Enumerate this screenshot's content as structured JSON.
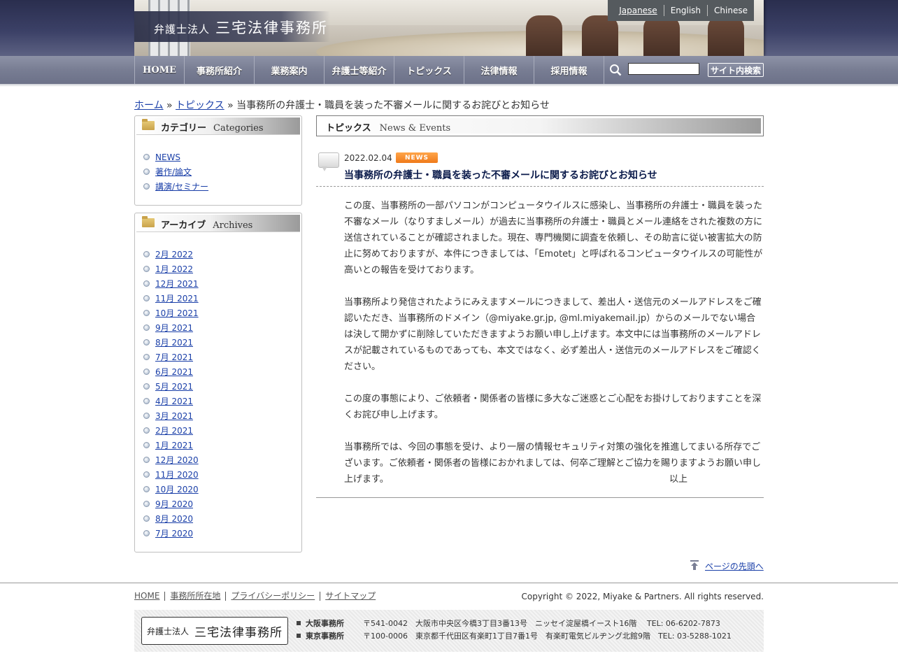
{
  "header": {
    "logo_small": "弁護士法人",
    "logo_big": "三宅法律事務所",
    "languages": [
      "Japanese",
      "English",
      "Chinese"
    ]
  },
  "nav": {
    "items": [
      "HOME",
      "事務所紹介",
      "業務案内",
      "弁護士等紹介",
      "トピックス",
      "法律情報",
      "採用情報"
    ],
    "search_button": "サイト内検索",
    "search_value": ""
  },
  "breadcrumb": {
    "home": "ホーム",
    "sep1": " » ",
    "topics": "トピックス",
    "sep2": " » ",
    "current": "当事務所の弁護士・職員を装った不審メールに関するお詫びとお知らせ"
  },
  "sidebar": {
    "categories": {
      "title": "カテゴリー",
      "title_en": "Categories",
      "items": [
        "NEWS",
        "著作/論文",
        "講演/セミナー"
      ]
    },
    "archives": {
      "title": "アーカイブ",
      "title_en": "Archives",
      "items": [
        "2月 2022",
        "1月 2022",
        "12月 2021",
        "11月 2021",
        "10月 2021",
        "9月 2021",
        "8月 2021",
        "7月 2021",
        "6月 2021",
        "5月 2021",
        "4月 2021",
        "3月 2021",
        "2月 2021",
        "1月 2021",
        "12月 2020",
        "11月 2020",
        "10月 2020",
        "9月 2020",
        "8月 2020",
        "7月 2020"
      ]
    }
  },
  "main": {
    "section_title": "トピックス",
    "section_title_en": "News & Events",
    "post": {
      "date": "2022.02.04",
      "badge": "NEWS",
      "title": "当事務所の弁護士・職員を装った不審メールに関するお詫びとお知らせ",
      "paragraphs": [
        "この度、当事務所の一部パソコンがコンピュータウイルスに感染し、当事務所の弁護士・職員を装った不審なメール（なりすましメール）が過去に当事務所の弁護士・職員とメール連絡をされた複数の方に送信されていることが確認されました。現在、専門機関に調査を依頼し、その助言に従い被害拡大の防止に努めておりますが、本件につきましては、「Emotet」と呼ばれるコンピュータウイルスの可能性が高いとの報告を受けております。",
        "当事務所より発信されたようにみえますメールにつきまして、差出人・送信元のメールアドレスをご確認いただき、当事務所のドメイン（@miyake.gr.jp, @ml.miyakemail.jp）からのメールでない場合は決して開かずに削除していただきますようお願い申し上げます。本文中には当事務所のメールアドレスが記載されているものであっても、本文ではなく、必ず差出人・送信元のメールアドレスをご確認ください。",
        "この度の事態により、ご依頼者・関係者の皆様に多大なご迷惑とご心配をお掛けしておりますことを深くお詫び申し上げます。",
        "当事務所では、今回の事態を受け、より一層の情報セキュリティ対策の強化を推進してまいる所存でございます。ご依頼者・関係者の皆様におかれましては、何卒ご理解とご協力を賜りますようお願い申し上げます。"
      ],
      "signoff": "以上"
    },
    "page_top_link": "ページの先頭へ"
  },
  "footer": {
    "links": [
      "HOME",
      "事務所所在地",
      "プライバシーポリシー",
      "サイトマップ"
    ],
    "copyright": "Copyright © 2022, Miyake & Partners. All rights reserved.",
    "logo_small": "弁護士法人",
    "logo_big": "三宅法律事務所",
    "offices": [
      {
        "name": "大阪事務所",
        "detail": "〒541-0042　大阪市中央区今橋3丁目3番13号　ニッセイ淀屋橋イースト16階　 TEL: 06-6202-7873"
      },
      {
        "name": "東京事務所",
        "detail": "〒100-0006　東京都千代田区有楽町1丁目7番1号　有楽町電気ビルヂング北館9階　TEL: 03-5288-1021"
      }
    ]
  },
  "colors": {
    "nav": "#787d93",
    "badge": "#f58a2a",
    "link": "#1a3fa8",
    "header_dark": "#3b4066"
  }
}
